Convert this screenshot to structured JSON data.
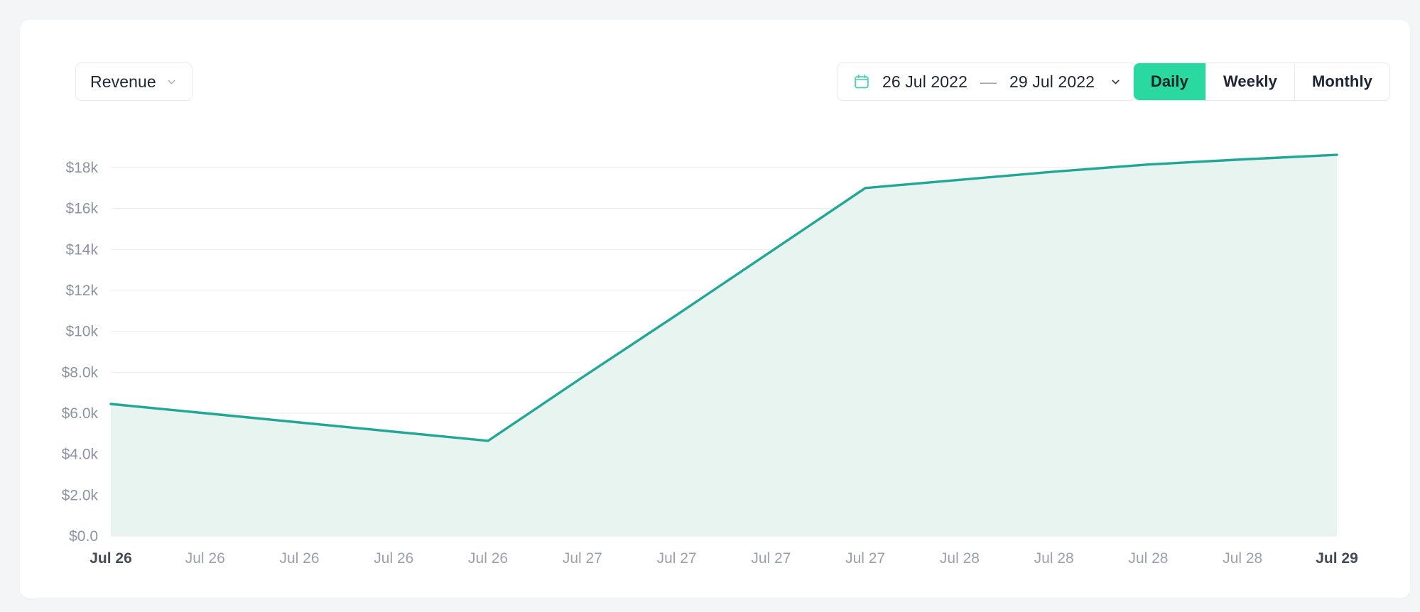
{
  "card": {
    "background": "#ffffff",
    "page_background": "#f4f5f7"
  },
  "toolbar": {
    "metric_select": {
      "label": "Revenue",
      "chevron_icon": "chevron-down-icon"
    },
    "date_range": {
      "calendar_icon": "calendar-icon",
      "start": "26 Jul 2022",
      "separator": "—",
      "end": "29 Jul 2022",
      "chevron_icon": "chevron-down-icon"
    },
    "granularity": {
      "selected": "Daily",
      "options": [
        {
          "label": "Daily",
          "active": true
        },
        {
          "label": "Weekly",
          "active": false
        },
        {
          "label": "Monthly",
          "active": false
        }
      ]
    }
  },
  "colors": {
    "accent_green": "#2ad9a0",
    "line_teal": "#22a698",
    "area_fill": "#e8f4f0",
    "grid": "#f0f1f3",
    "border": "#e7e9ee",
    "text_dark": "#1d2433",
    "text_muted": "#9aa1ae"
  },
  "chart_data": {
    "type": "area",
    "title": "Revenue",
    "xlabel": "",
    "ylabel": "",
    "grid": true,
    "legend": "none",
    "ylim": [
      0,
      19000
    ],
    "ytick_values": [
      0,
      2000,
      4000,
      6000,
      8000,
      10000,
      12000,
      14000,
      16000,
      18000
    ],
    "ytick_labels": [
      "$0.0",
      "$2.0k",
      "$4.0k",
      "$6.0k",
      "$8.0k",
      "$10k",
      "$12k",
      "$14k",
      "$16k",
      "$18k"
    ],
    "categories": [
      "Jul 26",
      "Jul 26",
      "Jul 26",
      "Jul 26",
      "Jul 26",
      "Jul 27",
      "Jul 27",
      "Jul 27",
      "Jul 27",
      "Jul 28",
      "Jul 28",
      "Jul 28",
      "Jul 28",
      "Jul 29"
    ],
    "xtick_bold": [
      0,
      13
    ],
    "series": [
      {
        "name": "Revenue",
        "values": [
          6450,
          6000,
          5550,
          5100,
          4650,
          7750,
          10800,
          13900,
          17000,
          17400,
          17800,
          18150,
          18400,
          18620
        ]
      }
    ]
  }
}
